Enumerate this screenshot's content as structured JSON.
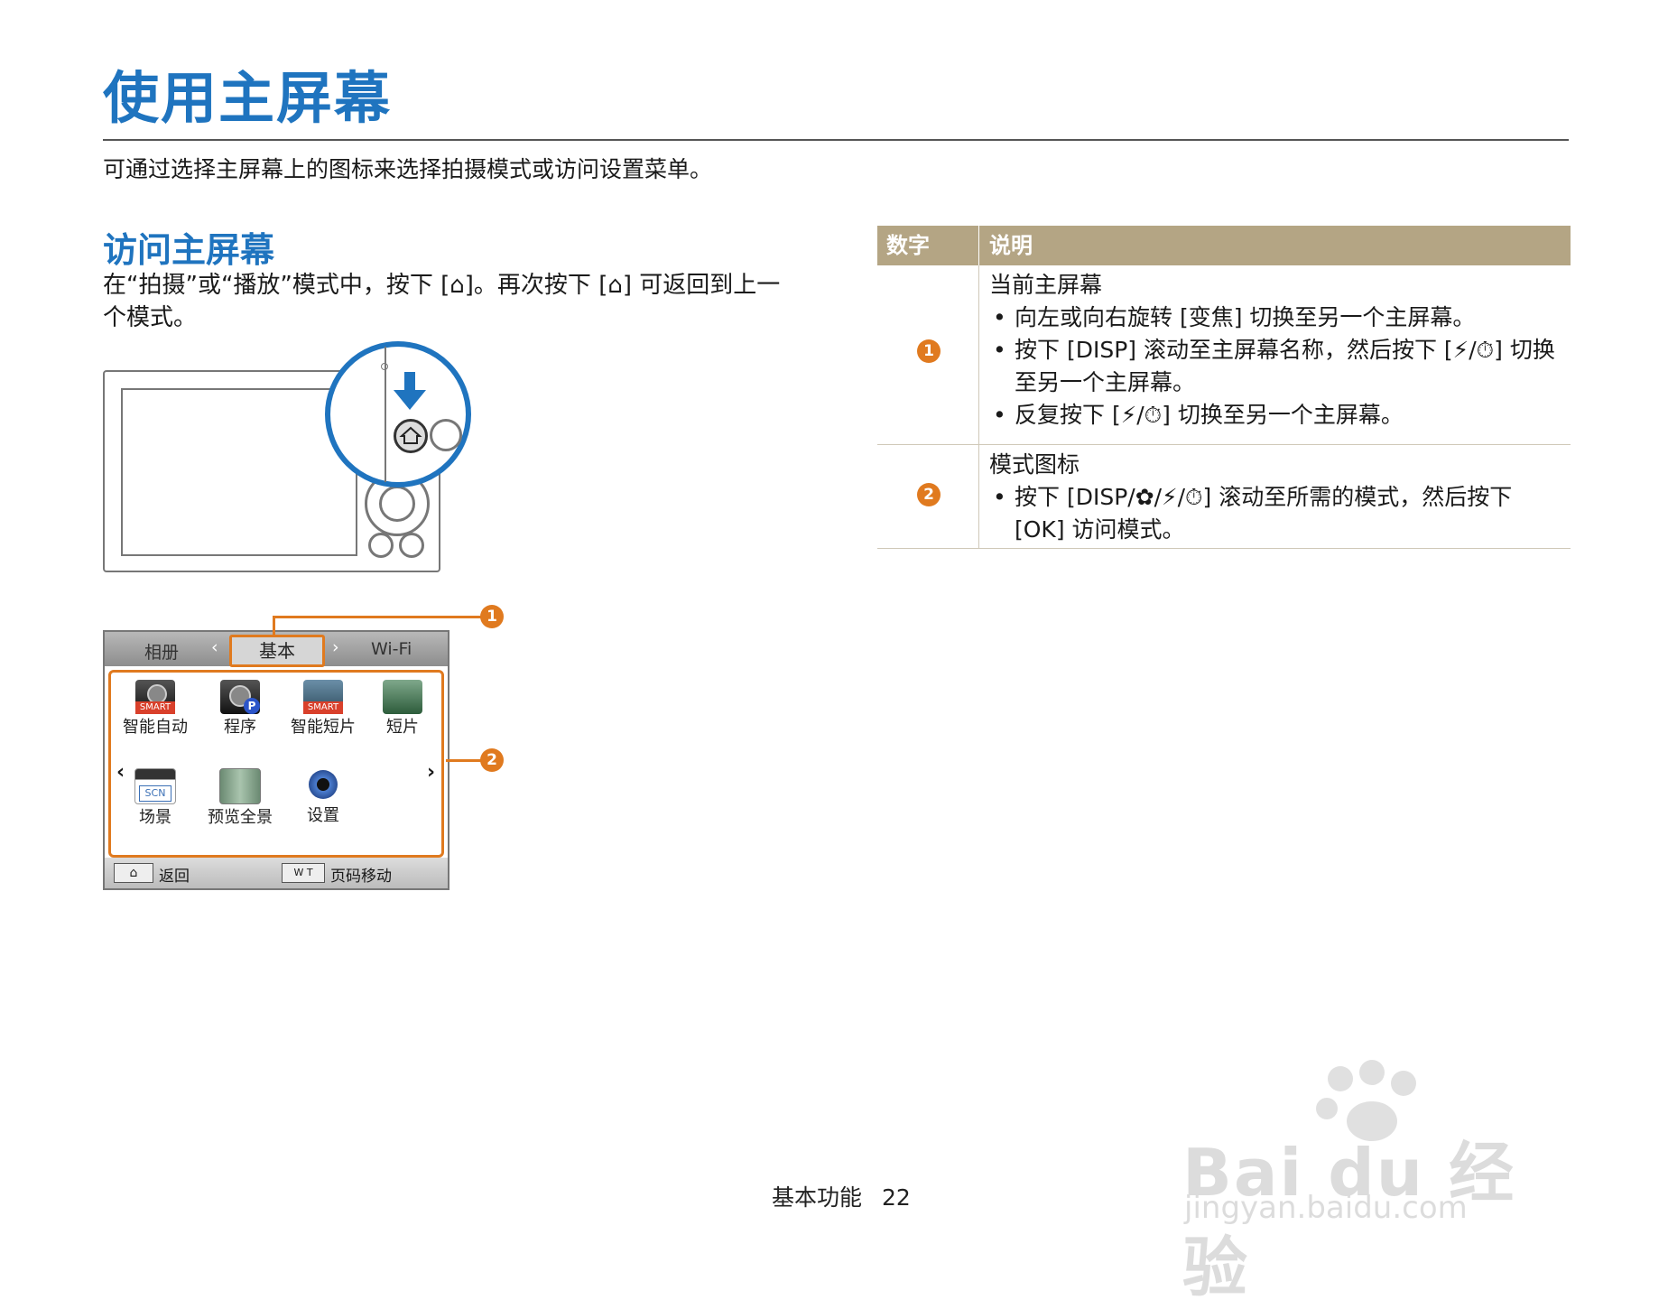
{
  "title": "使用主屏幕",
  "intro": "可通过选择主屏幕上的图标来选择拍摄模式或访问设置菜单。",
  "section": {
    "title": "访问主屏幕",
    "text": "在“拍摄”或“播放”模式中，按下 [⌂]。再次按下 [⌂] 可返回到上一个模式。"
  },
  "ui": {
    "tabs": [
      "相册",
      "基本",
      "Wi-Fi"
    ],
    "modes_row1": [
      "智能自动",
      "程序",
      "智能短片",
      "短片"
    ],
    "modes_row2": [
      "场景",
      "预览全景",
      "设置"
    ],
    "smart_badge": "SMART",
    "scn_badge": "SCN",
    "p_badge": "P",
    "footer_back": "返回",
    "footer_page": "页码移动",
    "footer_wt": "W T",
    "callouts": [
      "1",
      "2"
    ]
  },
  "table": {
    "header": [
      "数字",
      "说明"
    ],
    "rows": [
      {
        "num": "1",
        "title": "当前主屏幕",
        "bullets": [
          "向左或向右旋转 [变焦] 切换至另一个主屏幕。",
          "按下 [DISP] 滚动至主屏幕名称，然后按下 [⚡/⏱] 切换至另一个主屏幕。",
          "反复按下 [⚡/⏱] 切换至另一个主屏幕。"
        ]
      },
      {
        "num": "2",
        "title": "模式图标",
        "bullets": [
          "按下 [DISP/✿/⚡/⏱] 滚动至所需的模式，然后按下 [OK] 访问模式。"
        ]
      }
    ]
  },
  "footer": {
    "section": "基本功能",
    "page": "22"
  },
  "watermark": {
    "brand": "Bai du 经验",
    "url": "jingyan.baidu.com"
  },
  "colors": {
    "heading_blue": "#1f74bf",
    "accent_orange": "#e07a1f",
    "table_header": "#b4a584"
  }
}
